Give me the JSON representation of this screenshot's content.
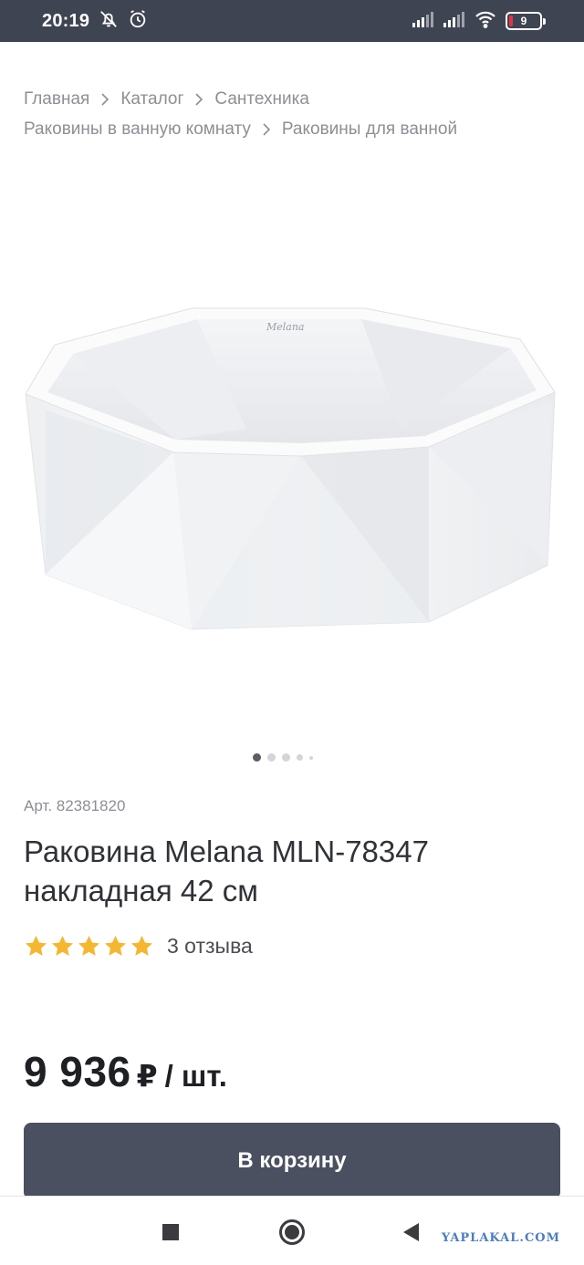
{
  "status_bar": {
    "time": "20:19",
    "battery_level": "9",
    "icons": [
      "alarm-off-icon",
      "alarm-icon",
      "signal-icon",
      "signal-icon",
      "wifi-icon",
      "battery-icon"
    ]
  },
  "breadcrumb": {
    "items": [
      "Главная",
      "Каталог",
      "Сантехника",
      "Раковины в ванную комнату",
      "Раковины для ванной"
    ]
  },
  "gallery": {
    "image_name": "product-photo",
    "image_label": "Melana",
    "dot_count": 5,
    "active_index": 0
  },
  "product": {
    "article": "Арт. 82381820",
    "title": "Раковина Melana MLN-78347 накладная 42 см",
    "rating": 5,
    "reviews": "3 отзыва",
    "price": "9 936",
    "currency": "₽",
    "unit": "/ шт.",
    "add_to_cart": "В корзину"
  },
  "colors": {
    "status_bar": "#3e4452",
    "button": "#4a5060",
    "star": "#f4b731",
    "watermark": "#4b7dc0"
  },
  "navbar": {
    "watermark": "YAPLAKAL.COM"
  }
}
